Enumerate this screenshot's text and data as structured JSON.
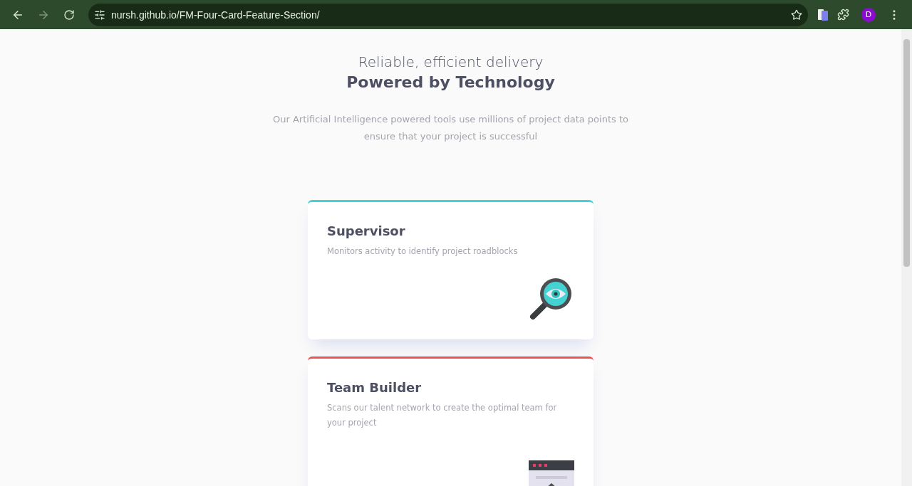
{
  "browser": {
    "url": "nursh.github.io/FM-Four-Card-Feature-Section/",
    "profile_initial": "D"
  },
  "header": {
    "subtitle": "Reliable, efficient delivery",
    "title": "Powered by Technology",
    "description": "Our Artificial Intelligence powered tools use millions of project data points to ensure that your project is successful"
  },
  "cards": [
    {
      "title": "Supervisor",
      "text": "Monitors activity to identify project roadblocks",
      "color": "#44d3d2",
      "kind": "supervisor"
    },
    {
      "title": "Team Builder",
      "text": "Scans our talent network to create the optimal team for your project",
      "color": "#ea5454",
      "kind": "builder"
    }
  ]
}
